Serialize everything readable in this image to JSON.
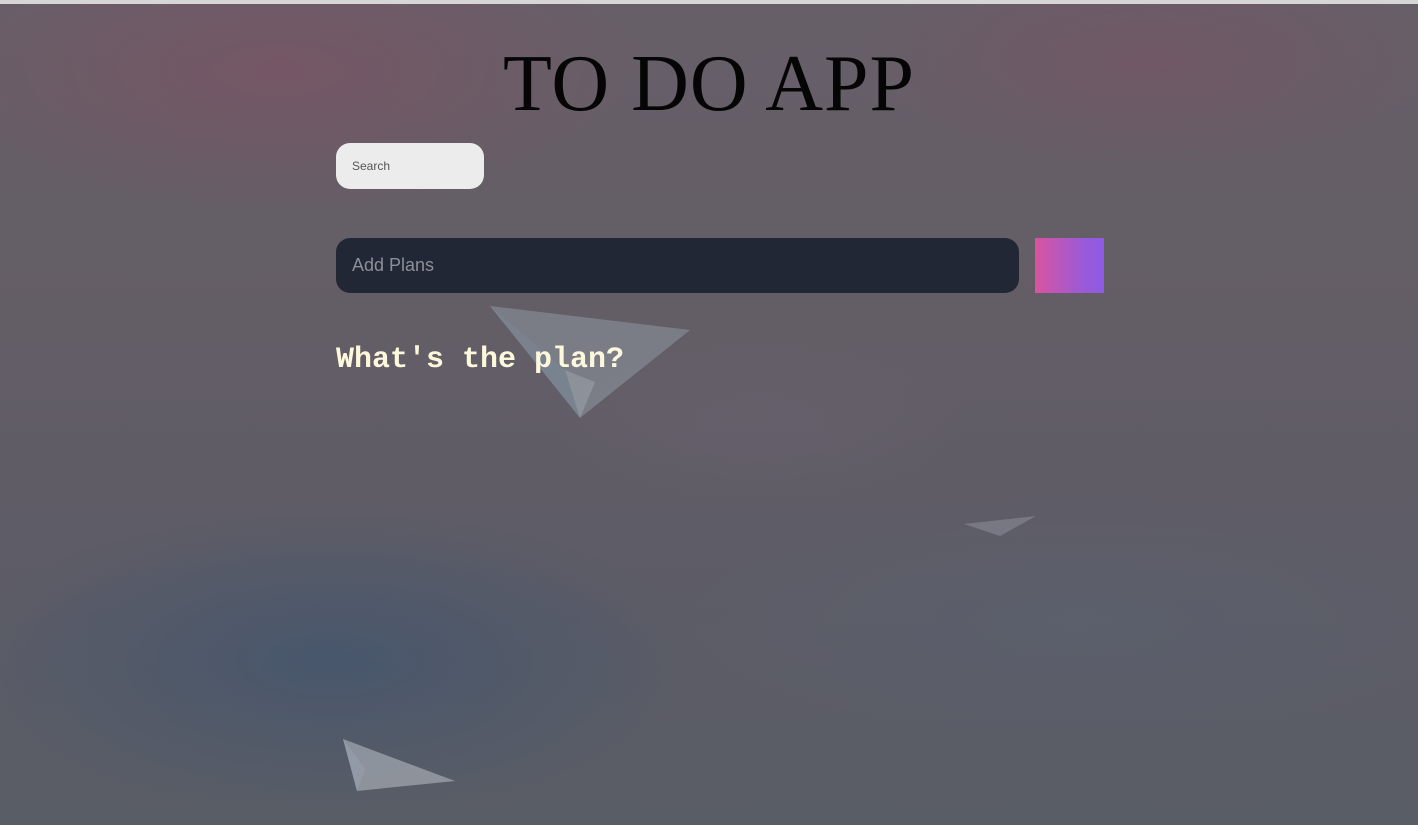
{
  "app": {
    "title": "TO DO APP"
  },
  "search": {
    "placeholder": "Search"
  },
  "add_plan": {
    "placeholder": "Add Plans",
    "button_colors": [
      "#d9549f",
      "#8e5ae6"
    ]
  },
  "plans": {
    "heading": "What's the plan?",
    "items": []
  },
  "background": {
    "icon": "paper-plane-icon"
  }
}
